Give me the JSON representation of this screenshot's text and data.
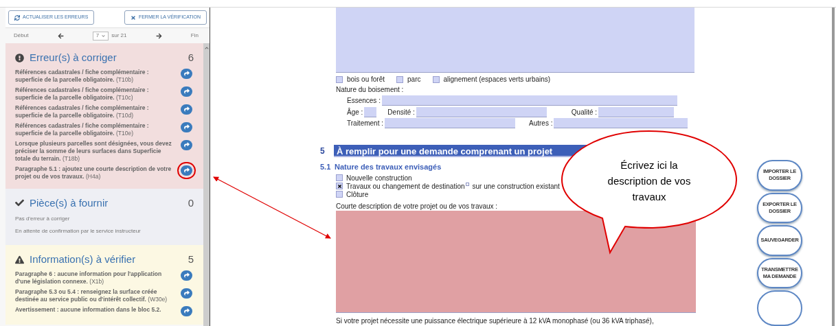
{
  "sidebar": {
    "toolbar": [
      {
        "label": "ACTUALISER LES ERREURS",
        "kind": "refresh"
      },
      {
        "label": "FERMER LA VÉRIFICATION",
        "kind": "close"
      }
    ],
    "pager": {
      "first": "Début",
      "page": "7",
      "of": "sur 21",
      "last": "Fin"
    },
    "sections": [
      {
        "kind": "error",
        "title": "Erreur(s) à corriger",
        "count": "6",
        "items": [
          {
            "text": "**Références cadastrales / fiche complémentaire : superficie de la parcelle obligatoire.** (T10b)",
            "highlighted": false
          },
          {
            "text": "**Références cadastrales / fiche complémentaire : superficie de la parcelle obligatoire.** (T10c)",
            "highlighted": false
          },
          {
            "text": "**Références cadastrales / fiche complémentaire : superficie de la parcelle obligatoire.** (T10d)",
            "highlighted": false
          },
          {
            "text": "**Références cadastrales / fiche complémentaire : superficie de la parcelle obligatoire.** (T10e)",
            "highlighted": false
          },
          {
            "text": "**Lorsque plusieurs parcelles sont désignées, vous devez préciser la somme de leurs surfaces dans Superficie totale du terrain.** (T18b)",
            "highlighted": false
          },
          {
            "text": "**Paragraphe 5.1 : ajoutez une courte description de votre projet ou de vos travaux.** (H4a)",
            "highlighted": true
          }
        ]
      },
      {
        "kind": "ok",
        "title": "Pièce(s) à fournir",
        "count": "0",
        "notes": [
          "Pas d'erreur à corriger",
          "En attente de confirmation par le service instructeur"
        ]
      },
      {
        "kind": "warning",
        "title": "Information(s) à vérifier",
        "count": "5",
        "items": [
          {
            "text": "**Paragraphe 6 : aucune information pour l'application d'une législation connexe.** (X1b)",
            "highlighted": false
          },
          {
            "text": "**Paragraphe 5.3 ou 5.4 : renseignez la surface créée destinée au service public ou d'intérêt collectif.** (W30e)",
            "highlighted": false
          },
          {
            "text": "**Avertissement : aucune information dans le bloc 5.2.**",
            "highlighted": false
          }
        ]
      }
    ]
  },
  "document": {
    "woodland_options": [
      {
        "label": "bois ou forêt",
        "checked": false
      },
      {
        "label": "parc",
        "checked": false
      },
      {
        "label": "alignement (espaces verts urbains)",
        "checked": false
      }
    ],
    "boisement_label": "Nature du boisement :",
    "field_rows": [
      [
        "Essences :"
      ],
      [
        "Âge :",
        "Densité :",
        "Qualité :"
      ],
      [
        "Traitement :",
        "Autres :"
      ]
    ],
    "section": {
      "number": "5",
      "title": "À remplir pour une demande comprenant un projet"
    },
    "subsection": {
      "number": "5.1",
      "title": "Nature des travaux envisagés"
    },
    "works_options": [
      {
        "label": "Nouvelle construction",
        "checked": false,
        "footnote": false
      },
      {
        "label": "Travaux ou changement de destination",
        "suffix": "sur une construction existant",
        "checked": true,
        "footnote": true
      },
      {
        "label": "Clôture",
        "checked": false,
        "footnote": false
      }
    ],
    "description_label": "Courte description de votre projet ou de vos travaux :",
    "footer_text": "Si votre projet nécessite une puissance électrique supérieure à 12 kVA monophasé (ou 36 kVA triphasé),"
  },
  "side_buttons": [
    "IMPORTER LE DOSSIER",
    "EXPORTER LE DOSSIER",
    "SAUVEGARDER",
    "TRANSMETTRE MA DEMANDE"
  ],
  "annotation": {
    "callout": "Écrivez ici la description de vos travaux"
  }
}
